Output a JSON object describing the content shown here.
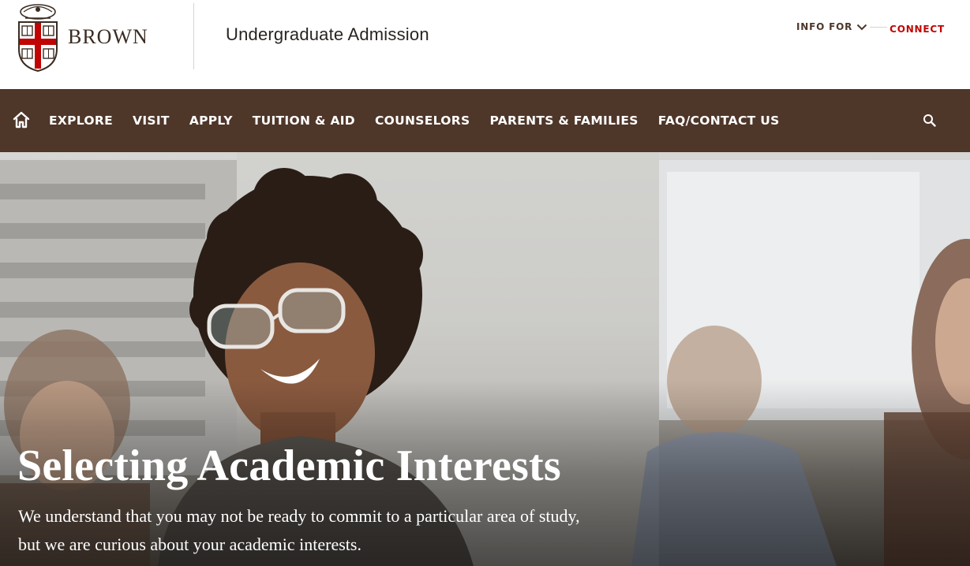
{
  "brand": {
    "wordmark": "BROWN",
    "site_title": "Undergraduate Admission"
  },
  "utility": {
    "info_for_label": "INFO FOR",
    "connect_label": "CONNECT"
  },
  "nav": {
    "items": [
      {
        "label": "EXPLORE"
      },
      {
        "label": "VISIT"
      },
      {
        "label": "APPLY"
      },
      {
        "label": "TUITION & AID"
      },
      {
        "label": "COUNSELORS"
      },
      {
        "label": "PARENTS & FAMILIES"
      },
      {
        "label": "FAQ/CONTACT US"
      }
    ]
  },
  "hero": {
    "heading": "Selecting Academic Interests",
    "lines": [
      "We understand that you may not be ready to commit to a particular area of study,",
      "but we are curious about your academic interests."
    ]
  },
  "icons": {
    "home": "home-icon",
    "search": "search-icon",
    "chevron": "chevron-down-icon"
  },
  "colors": {
    "brown": "#4e3629",
    "red": "#c00404",
    "white": "#ffffff"
  }
}
